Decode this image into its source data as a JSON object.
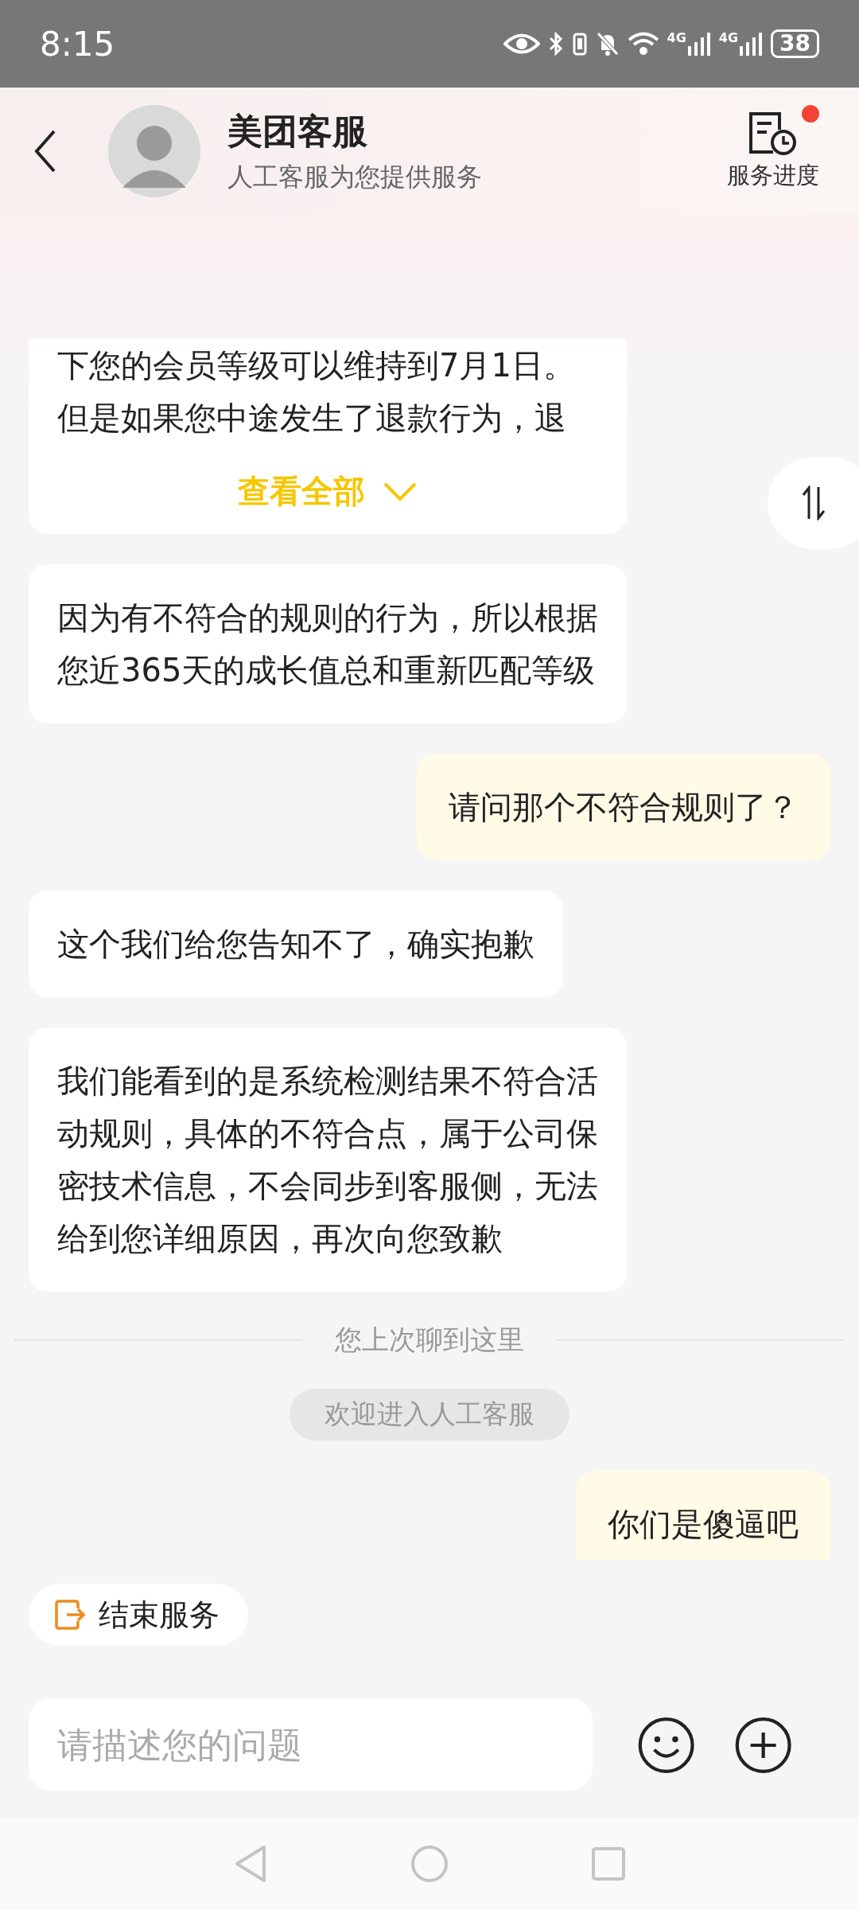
{
  "status_bar": {
    "time": "8:15",
    "networks": [
      "4G",
      "4G"
    ],
    "battery": "38"
  },
  "header": {
    "title": "美团客服",
    "subtitle": "人工客服为您提供服务",
    "progress_label": "服务进度",
    "progress_badge": true
  },
  "messages": [
    {
      "kind": "agent_collapsed",
      "lines": [
        "下您的会员等级可以维持到7月1日。",
        "但是如果您中途发生了退款行为，退"
      ],
      "expand_label": "查看全部"
    },
    {
      "kind": "agent",
      "text": "因为有不符合的规则的行为，所以根据您近365天的成长值总和重新匹配等级"
    },
    {
      "kind": "user",
      "text": "请问那个不符合规则了？"
    },
    {
      "kind": "agent",
      "text": "这个我们给您告知不了，确实抱歉"
    },
    {
      "kind": "agent",
      "text": "我们能看到的是系统检测结果不符合活动规则，具体的不符合点，属于公司保密技术信息，不会同步到客服侧，无法给到您详细原因，再次向您致歉"
    },
    {
      "kind": "divider",
      "text": "您上次聊到这里"
    },
    {
      "kind": "notice",
      "text": "欢迎进入人工客服"
    },
    {
      "kind": "user",
      "text": "你们是傻逼吧"
    }
  ],
  "end_service": "结束服务",
  "input": {
    "placeholder": "请描述您的问题"
  }
}
